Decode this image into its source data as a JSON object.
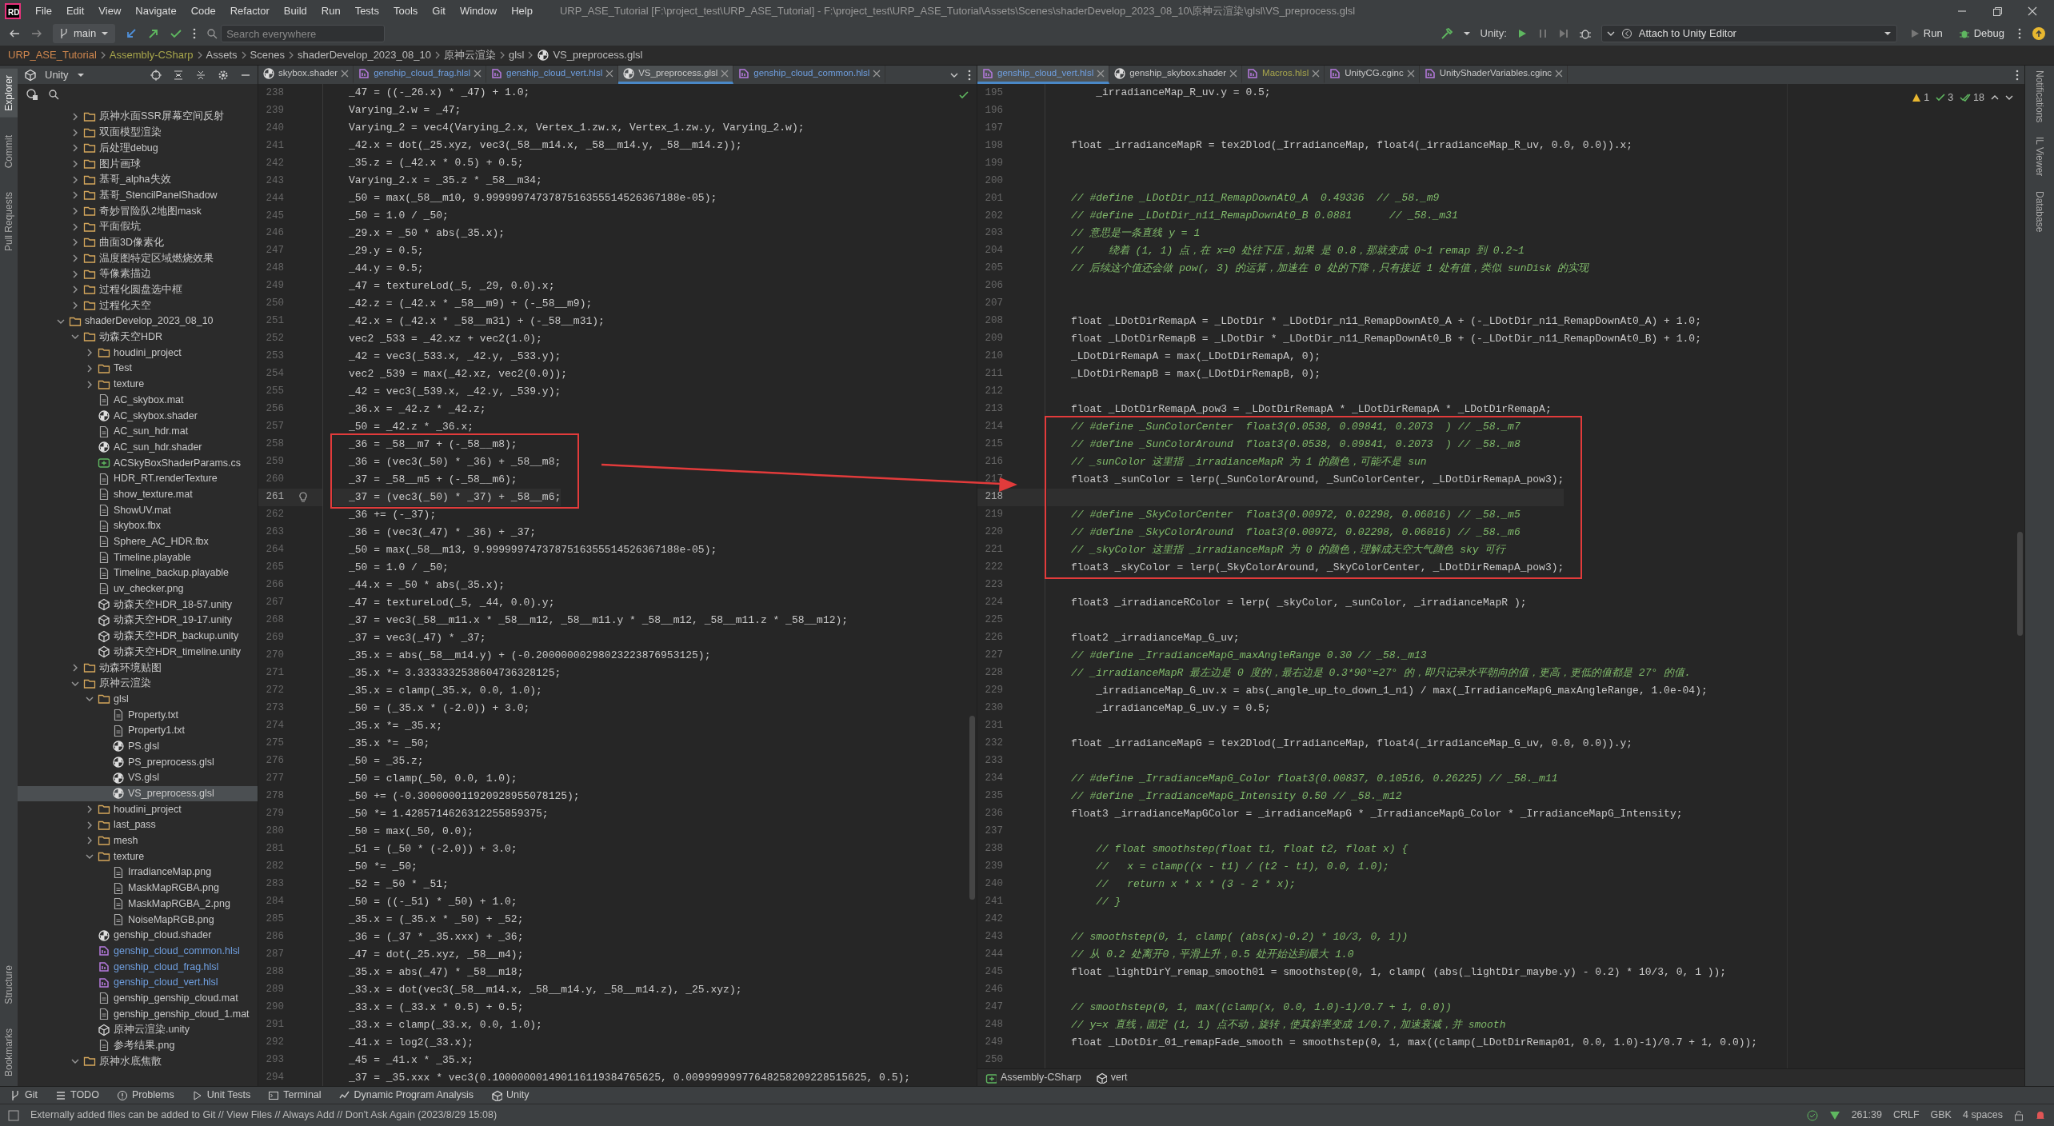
{
  "menu_bar": {
    "logo": "RD",
    "items": [
      "File",
      "Edit",
      "View",
      "Navigate",
      "Code",
      "Refactor",
      "Build",
      "Run",
      "Tests",
      "Tools",
      "Git",
      "Window",
      "Help"
    ],
    "title": "URP_ASE_Tutorial [F:\\project_test\\URP_ASE_Tutorial] - F:\\project_test\\URP_ASE_Tutorial\\Assets\\Scenes\\shaderDevelop_2023_08_10\\原神云渲染\\glsl\\VS_preprocess.glsl"
  },
  "toolbar": {
    "branch": "main",
    "search": {
      "placeholder": "Search everywhere"
    },
    "unity_label": "Unity:",
    "run_config": "Attach to Unity Editor",
    "run": "Run",
    "debug": "Debug"
  },
  "breadcrumb": [
    {
      "label": "URP_ASE_Tutorial",
      "kind": "project"
    },
    {
      "label": "Assembly-CSharp",
      "kind": "assembly"
    },
    {
      "label": "Assets",
      "kind": "folder"
    },
    {
      "label": "Scenes",
      "kind": "folder"
    },
    {
      "label": "shaderDevelop_2023_08_10",
      "kind": "folder"
    },
    {
      "label": "原神云渲染",
      "kind": "folder"
    },
    {
      "label": "glsl",
      "kind": "folder"
    },
    {
      "label": "VS_preprocess.glsl",
      "kind": "file"
    }
  ],
  "left_strip": {
    "top": [
      {
        "label": "Explorer",
        "selected": true
      },
      {
        "label": "Commit",
        "selected": false
      },
      {
        "label": "Pull Requests",
        "selected": false
      }
    ],
    "bottom": [
      {
        "label": "Structure",
        "selected": false
      },
      {
        "label": "Bookmarks",
        "selected": false
      }
    ]
  },
  "explorer": {
    "title": "Unity",
    "partial_group": [
      {
        "label": "原神水面SSR屏幕空间反射",
        "kind": "folder",
        "expanded": false,
        "selected": false,
        "modified": false
      },
      {
        "label": "双面模型渲染",
        "kind": "folder",
        "expanded": false,
        "selected": false,
        "modified": false
      },
      {
        "label": "后处理debug",
        "kind": "folder",
        "expanded": false,
        "selected": false,
        "modified": false
      },
      {
        "label": "图片画球",
        "kind": "folder",
        "expanded": false,
        "selected": false,
        "modified": false
      },
      {
        "label": "基哥_alpha失效",
        "kind": "folder",
        "expanded": false,
        "selected": false,
        "modified": false
      },
      {
        "label": "基哥_StencilPanelShadow",
        "kind": "folder",
        "expanded": false,
        "selected": false,
        "modified": false
      },
      {
        "label": "奇妙冒险队2地图mask",
        "kind": "folder",
        "expanded": false,
        "selected": false,
        "modified": false
      },
      {
        "label": "平面假坑",
        "kind": "folder",
        "expanded": false,
        "selected": false,
        "modified": false
      },
      {
        "label": "曲面3D像素化",
        "kind": "folder",
        "expanded": false,
        "selected": false,
        "modified": false
      },
      {
        "label": "温度图特定区域燃烧效果",
        "kind": "folder",
        "expanded": false,
        "selected": false,
        "modified": false
      },
      {
        "label": "等像素描边",
        "kind": "folder",
        "expanded": false,
        "selected": false,
        "modified": false
      },
      {
        "label": "过程化圆盘选中框",
        "kind": "folder",
        "expanded": false,
        "selected": false,
        "modified": false
      },
      {
        "label": "过程化天空",
        "kind": "folder",
        "expanded": false,
        "selected": false,
        "modified": false
      }
    ],
    "items": [
      {
        "label": "shaderDevelop_2023_08_10",
        "kind": "folder",
        "expanded": true,
        "selected": false,
        "modified": false,
        "children": [
          {
            "label": "动森天空HDR",
            "kind": "folder",
            "expanded": true,
            "selected": false,
            "modified": false,
            "children": [
              {
                "label": "houdini_project",
                "kind": "folder",
                "expanded": false,
                "selected": false,
                "modified": false
              },
              {
                "label": "Test",
                "kind": "folder",
                "expanded": false,
                "selected": false,
                "modified": false
              },
              {
                "label": "texture",
                "kind": "folder",
                "expanded": false,
                "selected": false,
                "modified": false
              },
              {
                "label": "AC_skybox.mat",
                "kind": "file",
                "selected": false,
                "modified": false
              },
              {
                "label": "AC_skybox.shader",
                "kind": "shader",
                "selected": false,
                "modified": false
              },
              {
                "label": "AC_sun_hdr.mat",
                "kind": "file",
                "selected": false,
                "modified": false
              },
              {
                "label": "AC_sun_hdr.shader",
                "kind": "shader",
                "selected": false,
                "modified": false
              },
              {
                "label": "ACSkyBoxShaderParams.cs",
                "kind": "csharp",
                "selected": false,
                "modified": false
              },
              {
                "label": "HDR_RT.renderTexture",
                "kind": "file",
                "selected": false,
                "modified": false
              },
              {
                "label": "show_texture.mat",
                "kind": "file",
                "selected": false,
                "modified": false
              },
              {
                "label": "ShowUV.mat",
                "kind": "file",
                "selected": false,
                "modified": false
              },
              {
                "label": "skybox.fbx",
                "kind": "file",
                "selected": false,
                "modified": false
              },
              {
                "label": "Sphere_AC_HDR.fbx",
                "kind": "file",
                "selected": false,
                "modified": false
              },
              {
                "label": "Timeline.playable",
                "kind": "file",
                "selected": false,
                "modified": false
              },
              {
                "label": "Timeline_backup.playable",
                "kind": "file",
                "selected": false,
                "modified": false
              },
              {
                "label": "uv_checker.png",
                "kind": "file",
                "selected": false,
                "modified": false
              },
              {
                "label": "动森天空HDR_18-57.unity",
                "kind": "unity",
                "selected": false,
                "modified": false
              },
              {
                "label": "动森天空HDR_19-17.unity",
                "kind": "unity",
                "selected": false,
                "modified": false
              },
              {
                "label": "动森天空HDR_backup.unity",
                "kind": "unity",
                "selected": false,
                "modified": false
              },
              {
                "label": "动森天空HDR_timeline.unity",
                "kind": "unity",
                "selected": false,
                "modified": false
              }
            ]
          },
          {
            "label": "动森环境贴图",
            "kind": "folder",
            "expanded": false,
            "selected": false,
            "modified": false
          },
          {
            "label": "原神云渲染",
            "kind": "folder",
            "expanded": true,
            "selected": false,
            "modified": false,
            "children": [
              {
                "label": "glsl",
                "kind": "folder",
                "expanded": true,
                "selected": false,
                "modified": false,
                "children": [
                  {
                    "label": "Property.txt",
                    "kind": "file",
                    "selected": false,
                    "modified": false
                  },
                  {
                    "label": "Property1.txt",
                    "kind": "file",
                    "selected": false,
                    "modified": false
                  },
                  {
                    "label": "PS.glsl",
                    "kind": "shader",
                    "selected": false,
                    "modified": false
                  },
                  {
                    "label": "PS_preprocess.glsl",
                    "kind": "shader",
                    "selected": false,
                    "modified": false
                  },
                  {
                    "label": "VS.glsl",
                    "kind": "shader",
                    "selected": false,
                    "modified": false
                  },
                  {
                    "label": "VS_preprocess.glsl",
                    "kind": "shader",
                    "selected": true,
                    "modified": false
                  }
                ]
              },
              {
                "label": "houdini_project",
                "kind": "folder",
                "expanded": false,
                "selected": false,
                "modified": false
              },
              {
                "label": "last_pass",
                "kind": "folder",
                "expanded": false,
                "selected": false,
                "modified": false
              },
              {
                "label": "mesh",
                "kind": "folder",
                "expanded": false,
                "selected": false,
                "modified": false
              },
              {
                "label": "texture",
                "kind": "folder",
                "expanded": true,
                "selected": false,
                "modified": false,
                "children": [
                  {
                    "label": "IrradianceMap.png",
                    "kind": "file",
                    "selected": false,
                    "modified": false
                  },
                  {
                    "label": "MaskMapRGBA.png",
                    "kind": "file",
                    "selected": false,
                    "modified": false
                  },
                  {
                    "label": "MaskMapRGBA_2.png",
                    "kind": "file",
                    "selected": false,
                    "modified": false
                  },
                  {
                    "label": "NoiseMapRGB.png",
                    "kind": "file",
                    "selected": false,
                    "modified": false
                  }
                ]
              },
              {
                "label": "genship_cloud.shader",
                "kind": "shader",
                "selected": false,
                "modified": false
              },
              {
                "label": "genship_cloud_common.hlsl",
                "kind": "hlsl",
                "selected": false,
                "modified": true
              },
              {
                "label": "genship_cloud_frag.hlsl",
                "kind": "hlsl",
                "selected": false,
                "modified": true
              },
              {
                "label": "genship_cloud_vert.hlsl",
                "kind": "hlsl",
                "selected": false,
                "modified": true
              },
              {
                "label": "genship_genship_cloud.mat",
                "kind": "file",
                "selected": false,
                "modified": false
              },
              {
                "label": "genship_genship_cloud_1.mat",
                "kind": "file",
                "selected": false,
                "modified": false
              },
              {
                "label": "原神云渲染.unity",
                "kind": "unity",
                "selected": false,
                "modified": false
              },
              {
                "label": "参考结果.png",
                "kind": "file",
                "selected": false,
                "modified": false
              }
            ]
          },
          {
            "label": "原神水底焦散",
            "kind": "folder",
            "expanded": true,
            "selected": false,
            "modified": false
          }
        ]
      }
    ]
  },
  "editors": [
    {
      "focused": true,
      "tabs": [
        {
          "label": "skybox.shader",
          "kind": "shader",
          "selected": false,
          "modified": false,
          "ignored": false
        },
        {
          "label": "genship_cloud_frag.hlsl",
          "kind": "hlsl",
          "selected": false,
          "modified": true,
          "ignored": false
        },
        {
          "label": "genship_cloud_vert.hlsl",
          "kind": "hlsl",
          "selected": false,
          "modified": true,
          "ignored": false
        },
        {
          "label": "VS_preprocess.glsl",
          "kind": "shader",
          "selected": true,
          "modified": false,
          "ignored": false
        },
        {
          "label": "genship_cloud_common.hlsl",
          "kind": "hlsl",
          "selected": false,
          "modified": true,
          "ignored": false
        }
      ],
      "blocks": [
        {
          "boxed": false,
          "lines": [
            {
              "n": "238",
              "text": "_47 = ((-_26.x) * _47) + 1.0;",
              "current": false
            },
            {
              "n": "239",
              "text": "Varying_2.w = _47;",
              "current": false
            },
            {
              "n": "240",
              "text": "Varying_2 = vec4(Varying_2.x, Vertex_1.zw.x, Vertex_1.zw.y, Varying_2.w);",
              "current": false
            },
            {
              "n": "241",
              "text": "_42.x = dot(_25.xyz, vec3(_58__m14.x, _58__m14.y, _58__m14.z));",
              "current": false
            },
            {
              "n": "242",
              "text": "_35.z = (_42.x * 0.5) + 0.5;",
              "current": false
            },
            {
              "n": "243",
              "text": "Varying_2.x = _35.z * _58__m34;",
              "current": false
            },
            {
              "n": "244",
              "text": "_50 = max(_58__m10, 9.9999997473787516355514526367188e-05);",
              "current": false
            },
            {
              "n": "245",
              "text": "_50 = 1.0 / _50;",
              "current": false
            },
            {
              "n": "246",
              "text": "_29.x = _50 * abs(_35.x);",
              "current": false
            },
            {
              "n": "247",
              "text": "_29.y = 0.5;",
              "current": false
            },
            {
              "n": "248",
              "text": "_44.y = 0.5;",
              "current": false
            },
            {
              "n": "249",
              "text": "_47 = textureLod(_5, _29, 0.0).x;",
              "current": false
            },
            {
              "n": "250",
              "text": "_42.z = (_42.x * _58__m9) + (-_58__m9);",
              "current": false
            },
            {
              "n": "251",
              "text": "_42.x = (_42.x * _58__m31) + (-_58__m31);",
              "current": false
            },
            {
              "n": "252",
              "text": "vec2 _533 = _42.xz + vec2(1.0);",
              "current": false
            },
            {
              "n": "253",
              "text": "_42 = vec3(_533.x, _42.y, _533.y);",
              "current": false
            },
            {
              "n": "254",
              "text": "vec2 _539 = max(_42.xz, vec2(0.0));",
              "current": false
            },
            {
              "n": "255",
              "text": "_42 = vec3(_539.x, _42.y, _539.y);",
              "current": false
            },
            {
              "n": "256",
              "text": "_36.x = _42.z * _42.z;",
              "current": false
            },
            {
              "n": "257",
              "text": "_50 = _42.z * _36.x;",
              "current": false
            }
          ]
        },
        {
          "boxed": true,
          "lines": [
            {
              "n": "258",
              "text": "_36 = _58__m7 + (-_58__m8);",
              "current": false
            },
            {
              "n": "259",
              "text": "_36 = (vec3(_50) * _36) + _58__m8;",
              "current": false
            },
            {
              "n": "260",
              "text": "_37 = _58__m5 + (-_58__m6);",
              "current": false
            },
            {
              "n": "261",
              "text": "_37 = (vec3(_50) * _37) + _58__m6;",
              "current": true
            }
          ]
        },
        {
          "boxed": false,
          "lines": [
            {
              "n": "262",
              "text": "_36 += (-_37);",
              "current": false
            },
            {
              "n": "263",
              "text": "_36 = (vec3(_47) * _36) + _37;",
              "current": false
            },
            {
              "n": "264",
              "text": "_50 = max(_58__m13, 9.9999997473787516355514526367188e-05);",
              "current": false
            },
            {
              "n": "265",
              "text": "_50 = 1.0 / _50;",
              "current": false
            },
            {
              "n": "266",
              "text": "_44.x = _50 * abs(_35.x);",
              "current": false
            },
            {
              "n": "267",
              "text": "_47 = textureLod(_5, _44, 0.0).y;",
              "current": false
            },
            {
              "n": "268",
              "text": "_37 = vec3(_58__m11.x * _58__m12, _58__m11.y * _58__m12, _58__m11.z * _58__m12);",
              "current": false
            },
            {
              "n": "269",
              "text": "_37 = vec3(_47) * _37;",
              "current": false
            },
            {
              "n": "270",
              "text": "_35.x = abs(_58__m14.y) + (-0.20000000298023223876953125);",
              "current": false
            },
            {
              "n": "271",
              "text": "_35.x *= 3.3333332538604736328125;",
              "current": false
            },
            {
              "n": "272",
              "text": "_35.x = clamp(_35.x, 0.0, 1.0);",
              "current": false
            },
            {
              "n": "273",
              "text": "_50 = (_35.x * (-2.0)) + 3.0;",
              "current": false
            },
            {
              "n": "274",
              "text": "_35.x *= _35.x;",
              "current": false
            },
            {
              "n": "275",
              "text": "_35.x *= _50;",
              "current": false
            },
            {
              "n": "276",
              "text": "_50 = _35.z;",
              "current": false
            },
            {
              "n": "277",
              "text": "_50 = clamp(_50, 0.0, 1.0);",
              "current": false
            },
            {
              "n": "278",
              "text": "_50 += (-0.300000011920928955078125);",
              "current": false
            },
            {
              "n": "279",
              "text": "_50 *= 1.4285714626312255859375;",
              "current": false
            },
            {
              "n": "280",
              "text": "_50 = max(_50, 0.0);",
              "current": false
            },
            {
              "n": "281",
              "text": "_51 = (_50 * (-2.0)) + 3.0;",
              "current": false
            },
            {
              "n": "282",
              "text": "_50 *= _50;",
              "current": false
            },
            {
              "n": "283",
              "text": "_52 = _50 * _51;",
              "current": false
            },
            {
              "n": "284",
              "text": "_50 = ((-_51) * _50) + 1.0;",
              "current": false
            },
            {
              "n": "285",
              "text": "_35.x = (_35.x * _50) + _52;",
              "current": false
            },
            {
              "n": "286",
              "text": "_36 = (_37 * _35.xxx) + _36;",
              "current": false
            },
            {
              "n": "287",
              "text": "_47 = dot(_25.xyz, _58__m4);",
              "current": false
            },
            {
              "n": "288",
              "text": "_35.x = abs(_47) * _58__m18;",
              "current": false
            },
            {
              "n": "289",
              "text": "_33.x = dot(vec3(_58__m14.x, _58__m14.y, _58__m14.z), _25.xyz);",
              "current": false
            },
            {
              "n": "290",
              "text": "_33.x = (_33.x * 0.5) + 0.5;",
              "current": false
            },
            {
              "n": "291",
              "text": "_33.x = clamp(_33.x, 0.0, 1.0);",
              "current": false
            },
            {
              "n": "292",
              "text": "_41.x = log2(_33.x);",
              "current": false
            },
            {
              "n": "293",
              "text": "_45 = _41.x * _35.x;",
              "current": false
            },
            {
              "n": "294",
              "text": "_37 = _35.xxx * vec3(0.100000001490116119384765625, 0.00999999977648258209228515625, 0.5);",
              "current": false
            }
          ]
        }
      ]
    },
    {
      "focused": false,
      "tabs": [
        {
          "label": "genship_cloud_vert.hlsl",
          "kind": "hlsl",
          "selected": true,
          "modified": true,
          "ignored": false
        },
        {
          "label": "genship_skybox.shader",
          "kind": "shader",
          "selected": false,
          "modified": false,
          "ignored": false
        },
        {
          "label": "Macros.hlsl",
          "kind": "hlsl",
          "selected": false,
          "modified": false,
          "ignored": true
        },
        {
          "label": "UnityCG.cginc",
          "kind": "hlsl",
          "selected": false,
          "modified": false,
          "ignored": false
        },
        {
          "label": "UnityShaderVariables.cginc",
          "kind": "hlsl",
          "selected": false,
          "modified": false,
          "ignored": false
        }
      ],
      "inspections": {
        "warnings": "1",
        "weak": "3",
        "typos": "18"
      },
      "blocks": [
        {
          "boxed": false,
          "lines": [
            {
              "n": "195",
              "text": "    _irradianceMap_R_uv.y = 0.5;",
              "kind": "code",
              "current": false
            },
            {
              "n": "196",
              "current": false
            },
            {
              "n": "197",
              "current": false
            },
            {
              "n": "198",
              "text": "float _irradianceMapR = tex2Dlod(_IrradianceMap, float4(_irradianceMap_R_uv, 0.0, 0.0)).x;",
              "kind": "code",
              "current": false
            },
            {
              "n": "199",
              "current": false
            },
            {
              "n": "200",
              "current": false
            },
            {
              "n": "201",
              "text": "// #define _LDotDir_n11_RemapDownAt0_A  0.49336  // _58._m9",
              "kind": "comment",
              "current": false
            },
            {
              "n": "202",
              "text": "// #define _LDotDir_n11_RemapDownAt0_B 0.0881      // _58._m31",
              "kind": "comment",
              "current": false
            },
            {
              "n": "203",
              "text": "// 意思是一条直线 y = 1",
              "kind": "comment",
              "current": false
            },
            {
              "n": "204",
              "text": "//    绕着 (1, 1) 点，在 x=0 处往下压，如果 是 0.8，那就变成 0~1 remap 到 0.2~1",
              "kind": "comment",
              "current": false
            },
            {
              "n": "205",
              "text": "// 后续这个值还会做 pow(, 3) 的运算，加速在 0 处的下降，只有接近 1 处有值，类似 sunDisk 的实现",
              "kind": "comment",
              "current": false
            },
            {
              "n": "206",
              "current": false
            },
            {
              "n": "207",
              "current": false
            },
            {
              "n": "208",
              "text": "float _LDotDirRemapA = _LDotDir * _LDotDir_n11_RemapDownAt0_A + (-_LDotDir_n11_RemapDownAt0_A) + 1.0;",
              "kind": "code",
              "current": false
            },
            {
              "n": "209",
              "text": "float _LDotDirRemapB = _LDotDir * _LDotDir_n11_RemapDownAt0_B + (-_LDotDir_n11_RemapDownAt0_B) + 1.0;",
              "kind": "code",
              "current": false
            },
            {
              "n": "210",
              "text": "_LDotDirRemapA = max(_LDotDirRemapA, 0);",
              "kind": "code",
              "current": false
            },
            {
              "n": "211",
              "text": "_LDotDirRemapB = max(_LDotDirRemapB, 0);",
              "kind": "code",
              "current": false
            },
            {
              "n": "212",
              "current": false
            },
            {
              "n": "213",
              "text": "float _LDotDirRemapA_pow3 = _LDotDirRemapA * _LDotDirRemapA * _LDotDirRemapA;",
              "kind": "code",
              "current": false
            }
          ]
        },
        {
          "boxed": true,
          "lines": [
            {
              "n": "214",
              "text": "// #define _SunColorCenter  float3(0.0538, 0.09841, 0.2073  ) // _58._m7",
              "kind": "comment",
              "current": false
            },
            {
              "n": "215",
              "text": "// #define _SunColorAround  float3(0.0538, 0.09841, 0.2073  ) // _58._m8",
              "kind": "comment",
              "current": false
            },
            {
              "n": "216",
              "text": "// _sunColor 这里指 _irradianceMapR 为 1 的颜色，可能不是 sun",
              "kind": "comment",
              "current": false
            },
            {
              "n": "217",
              "text": "float3 _sunColor = lerp(_SunColorAround, _SunColorCenter, _LDotDirRemapA_pow3);",
              "kind": "code",
              "current": false
            },
            {
              "n": "218",
              "current": true
            },
            {
              "n": "219",
              "text": "// #define _SkyColorCenter  float3(0.00972, 0.02298, 0.06016) // _58._m5",
              "kind": "comment",
              "current": false
            },
            {
              "n": "220",
              "text": "// #define _SkyColorAround  float3(0.00972, 0.02298, 0.06016) // _58._m6",
              "kind": "comment",
              "current": false
            },
            {
              "n": "221",
              "text": "// _skyColor 这里指 _irradianceMapR 为 0 的颜色，理解成天空大气颜色 sky 可行",
              "kind": "comment",
              "current": false
            },
            {
              "n": "222",
              "text": "float3 _skyColor = lerp(_SkyColorAround, _SkyColorCenter, _LDotDirRemapA_pow3);",
              "kind": "code",
              "current": false
            }
          ]
        },
        {
          "boxed": false,
          "lines": [
            {
              "n": "223",
              "current": false
            },
            {
              "n": "224",
              "text": "float3 _irradianceRColor = lerp( _skyColor, _sunColor, _irradianceMapR );",
              "kind": "code",
              "current": false
            },
            {
              "n": "225",
              "current": false
            },
            {
              "n": "226",
              "text": "float2 _irradianceMap_G_uv;",
              "kind": "code",
              "current": false
            },
            {
              "n": "227",
              "text": "// #define _IrradianceMapG_maxAngleRange 0.30 // _58._m13",
              "kind": "comment",
              "current": false
            },
            {
              "n": "228",
              "text": "// _irradianceMapR 最左边是 0 度的，最右边是 0.3*90°=27° 的，即只记录水平朝向的值，更高，更低的值都是 27° 的值.",
              "kind": "comment",
              "current": false
            },
            {
              "n": "229",
              "text": "    _irradianceMap_G_uv.x = abs(_angle_up_to_down_1_n1) / max(_IrradianceMapG_maxAngleRange, 1.0e-04);",
              "kind": "code",
              "current": false
            },
            {
              "n": "230",
              "text": "    _irradianceMap_G_uv.y = 0.5;",
              "kind": "code",
              "current": false
            },
            {
              "n": "231",
              "current": false
            },
            {
              "n": "232",
              "text": "float _irradianceMapG = tex2Dlod(_IrradianceMap, float4(_irradianceMap_G_uv, 0.0, 0.0)).y;",
              "kind": "code",
              "current": false
            },
            {
              "n": "233",
              "current": false
            },
            {
              "n": "234",
              "text": "// #define _IrradianceMapG_Color float3(0.00837, 0.10516, 0.26225) // _58._m11",
              "kind": "comment",
              "current": false
            },
            {
              "n": "235",
              "text": "// #define _IrradianceMapG_Intensity 0.50 // _58._m12",
              "kind": "comment",
              "current": false
            },
            {
              "n": "236",
              "text": "float3 _irradianceMapGColor = _irradianceMapG * _IrradianceMapG_Color * _IrradianceMapG_Intensity;",
              "kind": "code",
              "current": false
            },
            {
              "n": "237",
              "current": false
            },
            {
              "n": "238",
              "text": "    // float smoothstep(float t1, float t2, float x) {",
              "kind": "comment",
              "current": false
            },
            {
              "n": "239",
              "text": "    //   x = clamp((x - t1) / (t2 - t1), 0.0, 1.0);",
              "kind": "comment",
              "current": false
            },
            {
              "n": "240",
              "text": "    //   return x * x * (3 - 2 * x);",
              "kind": "comment",
              "current": false
            },
            {
              "n": "241",
              "text": "    // }",
              "kind": "comment",
              "current": false
            },
            {
              "n": "242",
              "current": false
            },
            {
              "n": "243",
              "text": "// smoothstep(0, 1, clamp( (abs(x)-0.2) * 10/3, 0, 1))",
              "kind": "comment",
              "current": false
            },
            {
              "n": "244",
              "text": "// 从 0.2 处离开0，平滑上升，0.5 处开始达到最大 1.0",
              "kind": "comment",
              "current": false
            },
            {
              "n": "245",
              "text": "float _lightDirY_remap_smooth01 = smoothstep(0, 1, clamp( (abs(_lightDir_maybe.y) - 0.2) * 10/3, 0, 1 ));",
              "kind": "code",
              "current": false
            },
            {
              "n": "246",
              "current": false
            },
            {
              "n": "247",
              "text": "// smoothstep(0, 1, max((clamp(x, 0.0, 1.0)-1)/0.7 + 1, 0.0))",
              "kind": "comment",
              "current": false
            },
            {
              "n": "248",
              "text": "// y=x 直线，固定 (1, 1) 点不动，旋转，使其斜率变成 1/0.7，加速衰减，并 smooth",
              "kind": "comment",
              "current": false
            },
            {
              "n": "249",
              "text": "float _LDotDir_01_remapFade_smooth = smoothstep(0, 1, max((clamp(_LDotDirRemap01, 0.0, 1.0)-1)/0.7 + 1, 0.0));",
              "kind": "code",
              "current": false
            },
            {
              "n": "250",
              "current": false
            }
          ]
        }
      ],
      "footer": [
        "Assembly-CSharp",
        "vert"
      ]
    }
  ],
  "right_strip": [
    "Notifications",
    "IL Viewer",
    "Database"
  ],
  "tool_windows": [
    "Git",
    "TODO",
    "Problems",
    "Unit Tests",
    "Terminal",
    "Dynamic Program Analysis",
    "Unity"
  ],
  "status_bar": {
    "message": "Externally added files can be added to Git // View Files // Always Add // Don't Ask Again (2023/8/29 15:08)",
    "position": "261:39",
    "line_ending": "CRLF",
    "encoding": "GBK",
    "indent": "4 spaces"
  }
}
